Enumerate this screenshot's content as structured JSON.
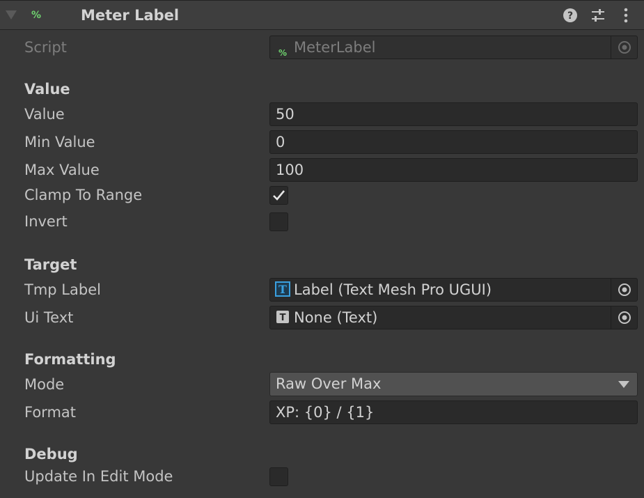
{
  "header": {
    "script_glyph": "%",
    "title": "Meter Label"
  },
  "script": {
    "label": "Script",
    "glyph": "%",
    "value": "MeterLabel"
  },
  "sections": {
    "value": "Value",
    "target": "Target",
    "formatting": "Formatting",
    "debug": "Debug"
  },
  "fields": {
    "value": {
      "label": "Value",
      "value": "50"
    },
    "min_value": {
      "label": "Min Value",
      "value": "0"
    },
    "max_value": {
      "label": "Max Value",
      "value": "100"
    },
    "clamp_to_range": {
      "label": "Clamp To Range",
      "checked": true
    },
    "invert": {
      "label": "Invert",
      "checked": false
    },
    "tmp_label": {
      "label": "Tmp Label",
      "value": "Label (Text Mesh Pro UGUI)",
      "icon": "T"
    },
    "ui_text": {
      "label": "Ui Text",
      "value": "None (Text)",
      "icon": "T"
    },
    "mode": {
      "label": "Mode",
      "value": "Raw Over Max"
    },
    "format": {
      "label": "Format",
      "value": "XP: {0} / {1}"
    },
    "update_in_edit_mode": {
      "label": "Update In Edit Mode",
      "checked": false
    }
  },
  "colors": {
    "background": "#383838",
    "field": "#2a2a2a",
    "script_glyph": "#6fd36f",
    "tmp_icon": "#3aa0e0"
  }
}
